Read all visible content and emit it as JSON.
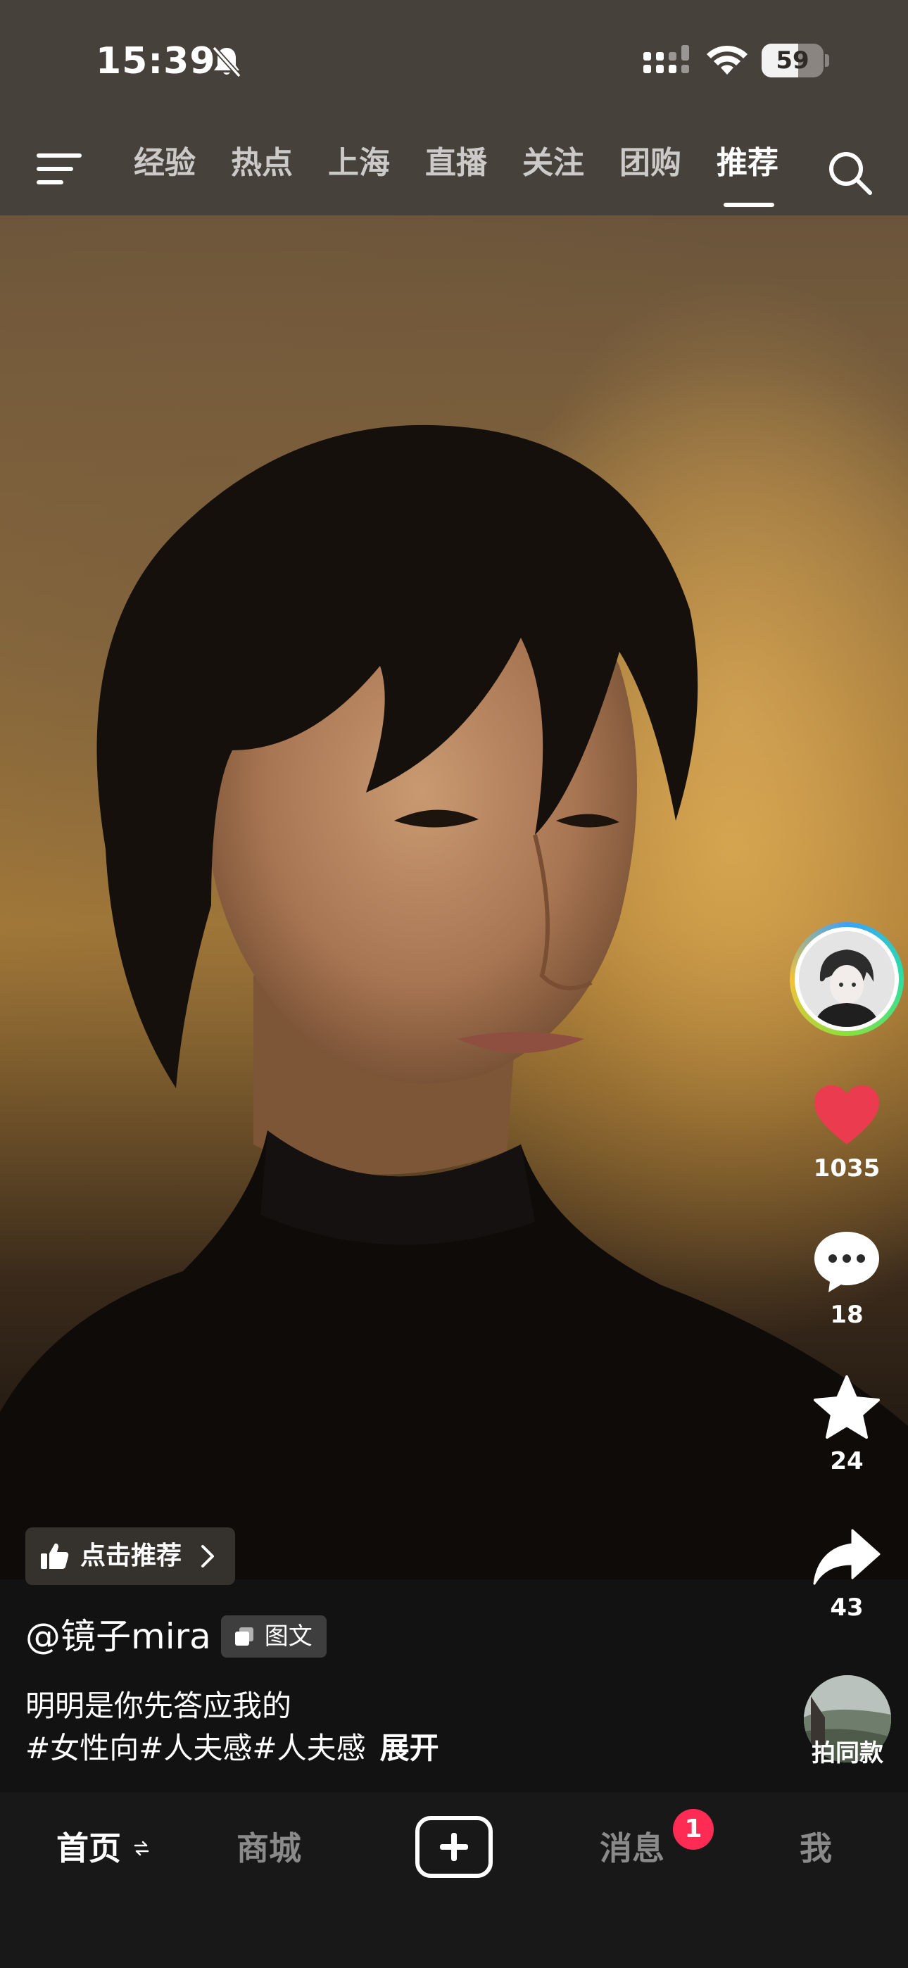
{
  "status_bar": {
    "time": "15:39",
    "battery_level": "59",
    "battery_fraction": 0.59,
    "icons": [
      "bell-muted-icon",
      "cellular-signal-icon",
      "wifi-icon",
      "battery-icon"
    ]
  },
  "top_nav": {
    "menu_icon": "menu-icon",
    "tabs": [
      {
        "label": "经验"
      },
      {
        "label": "热点"
      },
      {
        "label": "上海"
      },
      {
        "label": "直播"
      },
      {
        "label": "关注"
      },
      {
        "label": "团购"
      },
      {
        "label": "推荐"
      }
    ],
    "active_tab": "推荐",
    "search_icon": "search-icon"
  },
  "post": {
    "recommend_chip": "点击推荐",
    "author": "@镜子mira",
    "type_badge": "图文",
    "caption": "明明是你先答应我的",
    "hashtags": "#女性向#人夫感#人夫感",
    "expand": "展开"
  },
  "actions": {
    "likes": "1035",
    "comments": "18",
    "favorites": "24",
    "shares": "43",
    "same_style": "拍同款"
  },
  "colors": {
    "like_red": "#fe2c55",
    "heart_red": "#ea3c4e",
    "badge_red": "#fe2c55",
    "nav_bg": "#47413b",
    "tabbar_bg": "#181818"
  },
  "bottom_tabs": {
    "home": "首页",
    "mall": "商城",
    "create_icon": "plus-icon",
    "messages": "消息",
    "messages_badge": "1",
    "me": "我",
    "active": "首页"
  }
}
